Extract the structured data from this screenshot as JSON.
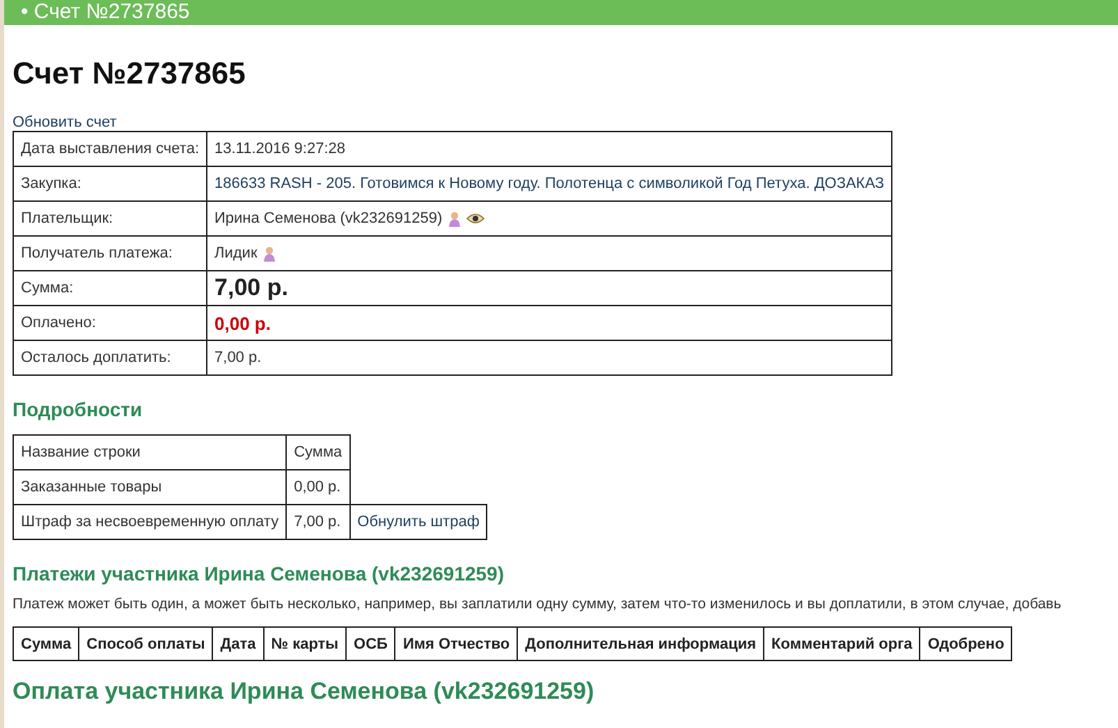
{
  "header": {
    "title": "• Счет №2737865"
  },
  "title": "Счет №2737865",
  "refresh_link": "Обновить счет",
  "invoice": [
    {
      "kind": "plain",
      "label": "Дата выставления счета:",
      "value": "13.11.2016 9:27:28"
    },
    {
      "kind": "link",
      "label": "Закупка:",
      "value": "186633 RASH - 205. Готовимся к Новому году. Полотенца с символикой Год Петуха. ДОЗАКАЗ"
    },
    {
      "kind": "user_watch",
      "label": "Плательщик:",
      "value": "Ирина Семенова (vk232691259)"
    },
    {
      "kind": "user",
      "label": "Получатель платежа:",
      "value": "Лидик"
    },
    {
      "kind": "total",
      "label": "Сумма:",
      "value": "7,00 р."
    },
    {
      "kind": "unpaid",
      "label": "Оплачено:",
      "value": "0,00 р."
    },
    {
      "kind": "plain",
      "label": "Осталось доплатить:",
      "value": "7,00 р."
    }
  ],
  "details": {
    "heading": "Подробности",
    "columns": [
      "Название строки",
      "Сумма"
    ],
    "rows": [
      {
        "name": "Заказанные товары",
        "amount": "0,00 р."
      },
      {
        "name": "Штраф за несвоевременную оплату",
        "amount": "7,00 р.",
        "action": "Обнулить штраф"
      }
    ]
  },
  "payments": {
    "heading": "Платежи участника Ирина Семенова (vk232691259)",
    "note": "Платеж может быть один, а может быть несколько, например, вы заплатили одну сумму, затем что-то изменилось и вы доплатили, в этом случае, добавь",
    "columns": [
      "Сумма",
      "Способ оплаты",
      "Дата",
      "№ карты",
      "ОСБ",
      "Имя Отчество",
      "Дополнительная информация",
      "Комментарий орга",
      "Одобрено"
    ]
  },
  "payment_form": {
    "heading": "Оплата участника Ирина Семенова (vk232691259)"
  }
}
